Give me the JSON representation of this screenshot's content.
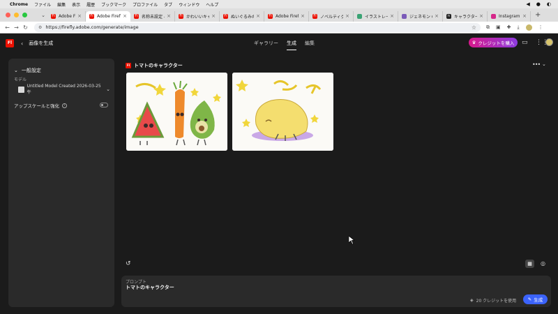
{
  "menubar": {
    "app": "Chrome",
    "items": [
      "ファイル",
      "編集",
      "表示",
      "履歴",
      "ブックマーク",
      "プロファイル",
      "タブ",
      "ウィンドウ",
      "ヘルプ"
    ]
  },
  "tabs": [
    {
      "label": "Adobe Firefly",
      "color": "#eb1000",
      "glyph": "Fl"
    },
    {
      "label": "Adobe Firefly",
      "color": "#eb1000",
      "glyph": "Fl"
    },
    {
      "label": "名称未設定 - 20",
      "color": "#eb1000",
      "glyph": "Fl"
    },
    {
      "label": "かわいいキャラ",
      "color": "#eb1000",
      "glyph": "Fl"
    },
    {
      "label": "ぬいぐるみの形",
      "color": "#eb1000",
      "glyph": "Fl"
    },
    {
      "label": "Adobe Firefly",
      "color": "#eb1000",
      "glyph": "Fl"
    },
    {
      "label": "ノベルティグッ",
      "color": "#eb1000",
      "glyph": "Fl"
    },
    {
      "label": "イラストレーテ",
      "color": "#3aa374",
      "glyph": ""
    },
    {
      "label": "ジェネモン Gen",
      "color": "#7a5ab8",
      "glyph": ""
    },
    {
      "label": "キャラクターデ",
      "color": "#222222",
      "glyph": "n"
    },
    {
      "label": "Instagram",
      "color": "#d6288a",
      "glyph": ""
    }
  ],
  "address": {
    "url": "https://firefly.adobe.com/generate/image"
  },
  "header": {
    "logo": "Fl",
    "title": "画像を生成",
    "nav": [
      "ギャラリー",
      "生成",
      "編集"
    ],
    "credit_button": "クレジットを購入"
  },
  "sidebar": {
    "section_title": "一般設定",
    "model_label": "モデル",
    "model_value": "Untitled Model Created 2026-03-25 午",
    "upscale_label": "アップスケールと強化"
  },
  "main": {
    "title": "トマトのキャラクター"
  },
  "prompt": {
    "label": "プロンプト",
    "value": "トマトのキャラクター",
    "credits_text": "20 クレジットを使用",
    "generate_label": "生成"
  },
  "colors": {
    "accent_red": "#eb1000",
    "generate_blue": "#3b63fb",
    "credit_gradient_start": "#d6188b",
    "credit_gradient_end": "#8d3be0"
  }
}
